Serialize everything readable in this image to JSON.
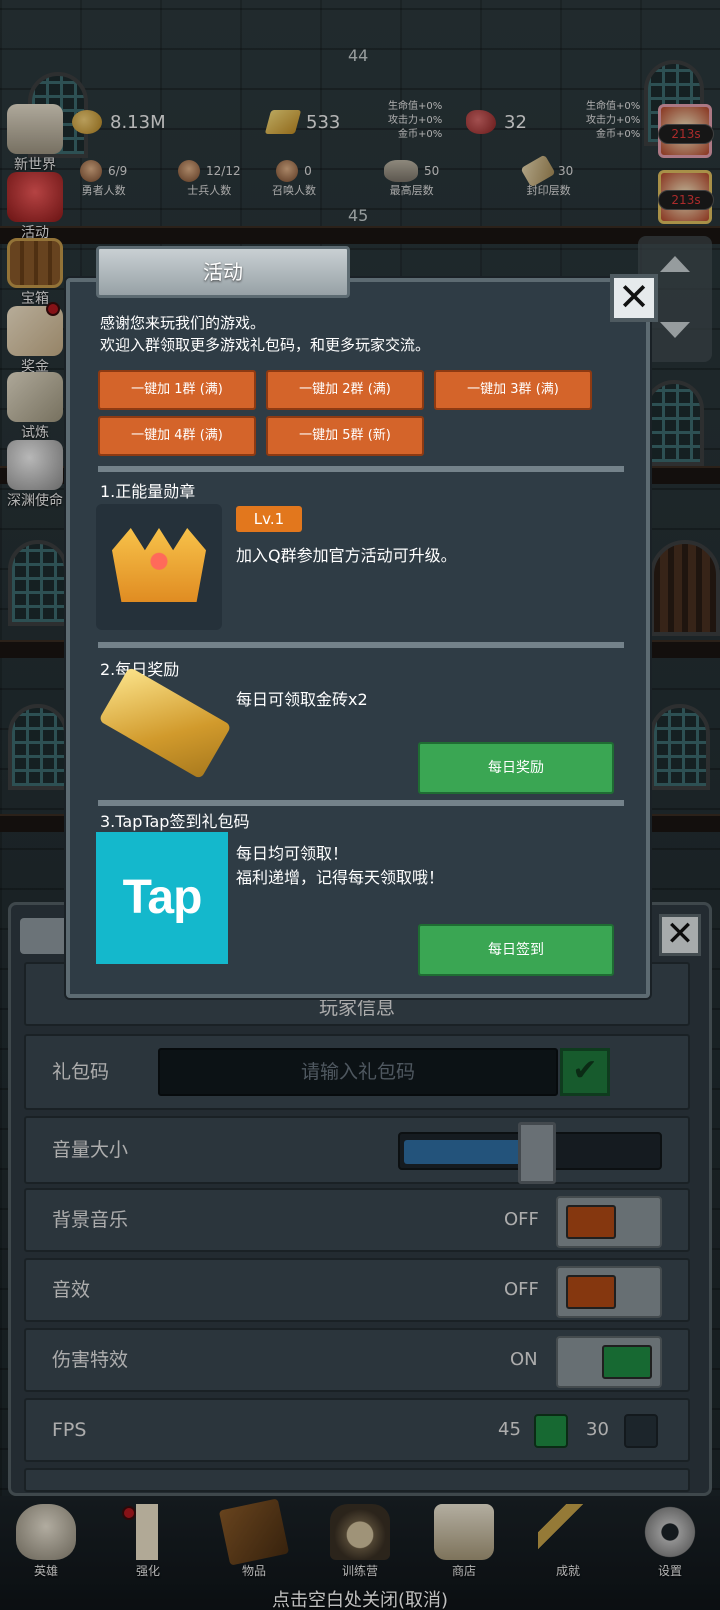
{
  "floors": {
    "upper": "44",
    "lower": "45"
  },
  "resources": {
    "coins": "8.13M",
    "bricks": "533",
    "meat": "32",
    "buff_left": [
      "生命值+0%",
      "攻击力+0%",
      "金币+0%"
    ],
    "buff_right": [
      "生命值+0%",
      "攻击力+0%",
      "金币+0%"
    ]
  },
  "counts": [
    {
      "value": "6/9",
      "label": "勇者人数"
    },
    {
      "value": "12/12",
      "label": "士兵人数"
    },
    {
      "value": "0",
      "label": "召唤人数"
    },
    {
      "value": "50",
      "label": "最高层数"
    },
    {
      "value": "30",
      "label": "封印层数"
    }
  ],
  "side_menu": [
    "新世界",
    "活动",
    "宝箱",
    "奖金",
    "试炼",
    "深渊使命"
  ],
  "right_timers": [
    "213s",
    "213s"
  ],
  "dialog": {
    "title": "活动",
    "intro_line1": "感谢您来玩我们的游戏。",
    "intro_line2": "欢迎入群领取更多游戏礼包码，和更多玩家交流。",
    "group_buttons": [
      "一键加 1群 (满)",
      "一键加 2群 (满)",
      "一键加 3群 (满)",
      "一键加 4群 (满)",
      "一键加 5群 (新)"
    ],
    "section1": {
      "title": "1.正能量勋章",
      "level": "Lv.1",
      "desc": "加入Q群参加官方活动可升级。"
    },
    "section2": {
      "title": "2.每日奖励",
      "desc": "每日可领取金砖x2",
      "button": "每日奖励"
    },
    "section3": {
      "title": "3.TapTap签到礼包码",
      "desc_line1": "每日均可领取！",
      "desc_line2": "福利递增，记得每天领取哦！",
      "button": "每日签到",
      "logo_text": "Tap"
    }
  },
  "settings": {
    "hidden_row": "玩家信息",
    "gift_code_label": "礼包码",
    "gift_code_placeholder": "请输入礼包码",
    "volume_label": "音量大小",
    "volume_level": 0.47,
    "bgm_label": "背景音乐",
    "bgm_state": "OFF",
    "sfx_label": "音效",
    "sfx_state": "OFF",
    "damage_label": "伤害特效",
    "damage_state": "ON",
    "fps_label": "FPS",
    "fps_options": [
      "45",
      "30"
    ],
    "fps_selected": "45"
  },
  "bottom_nav": [
    "英雄",
    "强化",
    "物品",
    "训练营",
    "商店",
    "成就",
    "设置"
  ],
  "close_hint": "点击空白处关闭(取消)",
  "colors": {
    "orange_button": "#d4642a",
    "green_button": "#3aa653",
    "toggle_off": "#b24a14",
    "toggle_on": "#1f8c43",
    "taptap": "#14b8cc"
  }
}
